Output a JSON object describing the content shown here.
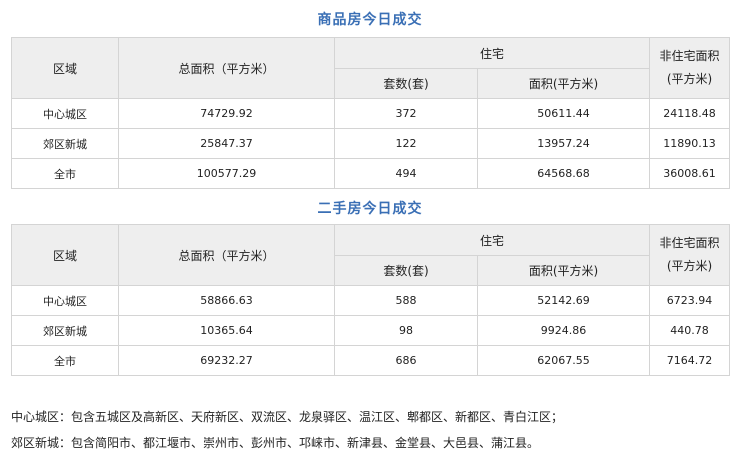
{
  "tables": [
    {
      "title": "商品房今日成交",
      "headers": {
        "region": "区域",
        "total_area": "总面积（平方米）",
        "residential": "住宅",
        "units": "套数(套)",
        "res_area": "面积(平方米)",
        "non_res_line1": "非住宅面积",
        "non_res_line2": "(平方米)"
      },
      "rows": [
        {
          "region": "中心城区",
          "total_area": "74729.92",
          "units": "372",
          "res_area": "50611.44",
          "non_res": "24118.48"
        },
        {
          "region": "郊区新城",
          "total_area": "25847.37",
          "units": "122",
          "res_area": "13957.24",
          "non_res": "11890.13"
        },
        {
          "region": "全市",
          "total_area": "100577.29",
          "units": "494",
          "res_area": "64568.68",
          "non_res": "36008.61"
        }
      ]
    },
    {
      "title": "二手房今日成交",
      "headers": {
        "region": "区域",
        "total_area": "总面积（平方米）",
        "residential": "住宅",
        "units": "套数(套)",
        "res_area": "面积(平方米)",
        "non_res_line1": "非住宅面积",
        "non_res_line2": "(平方米)"
      },
      "rows": [
        {
          "region": "中心城区",
          "total_area": "58866.63",
          "units": "588",
          "res_area": "52142.69",
          "non_res": "6723.94"
        },
        {
          "region": "郊区新城",
          "total_area": "10365.64",
          "units": "98",
          "res_area": "9924.86",
          "non_res": "440.78"
        },
        {
          "region": "全市",
          "total_area": "69232.27",
          "units": "686",
          "res_area": "62067.55",
          "non_res": "7164.72"
        }
      ]
    }
  ],
  "notes": [
    "中心城区：包含五城区及高新区、天府新区、双流区、龙泉驿区、温江区、郫都区、新都区、青白江区；",
    "郊区新城：包含简阳市、都江堰市、崇州市、彭州市、邛崃市、新津县、金堂县、大邑县、蒲江县。"
  ]
}
